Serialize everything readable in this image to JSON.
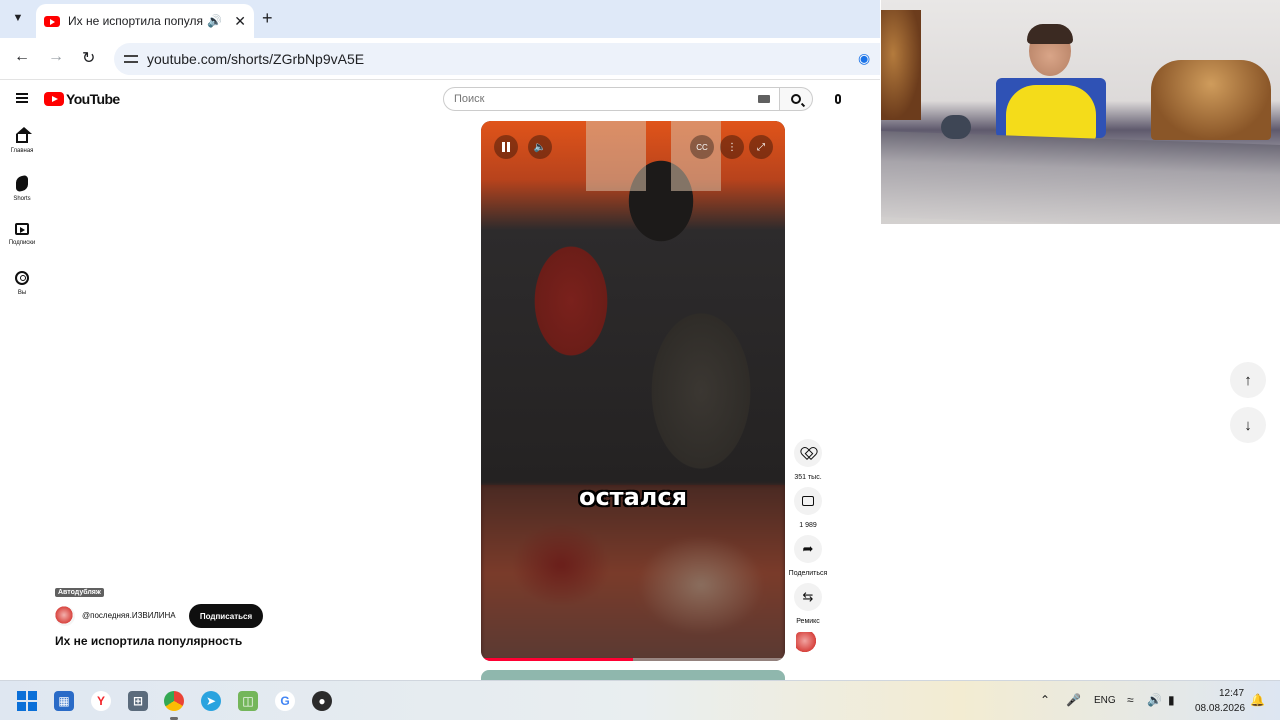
{
  "browser": {
    "tab_title": "Их не испортила популярнос",
    "url": "youtube.com/shorts/ZGrbNp9vA5E"
  },
  "youtube": {
    "logo_text": "YouTube",
    "search_placeholder": "Поиск",
    "rail": [
      {
        "label": "Главная",
        "icon": "home-icon"
      },
      {
        "label": "Shorts",
        "icon": "shorts-icon"
      },
      {
        "label": "Подписки",
        "icon": "subscriptions-icon"
      },
      {
        "label": "Вы",
        "icon": "you-icon"
      }
    ]
  },
  "short": {
    "caption": "остался",
    "progress": 0.5,
    "dub_badge": "Автодубляж",
    "channel_handle": "@последняя.ИЗВИЛИНА",
    "subscribe_label": "Подписаться",
    "title": "Их не испортила популярность",
    "actions": {
      "likes": "351 тыс.",
      "comments": "1 989",
      "share": "Поделиться",
      "remix": "Ремикс"
    }
  },
  "taskbar": {
    "language": "ENG",
    "time": "12:47",
    "date": "08.08.2026"
  },
  "colors": {
    "accent_red": "#ff0000",
    "progress_red": "#ff0033",
    "subscribe_bg": "#0f0f0f"
  }
}
